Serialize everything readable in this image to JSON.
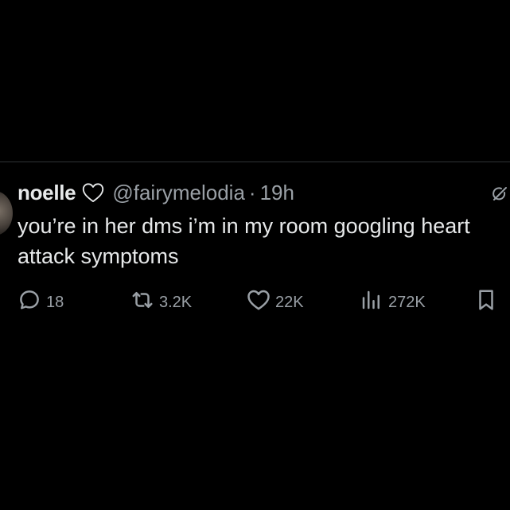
{
  "tweet": {
    "display_name": "noelle",
    "name_icon": "heart-outline-icon",
    "handle": "@fairymelodia",
    "separator": "·",
    "time": "19h",
    "text": "you’re in her dms i’m in my room googling heart attack symptoms"
  },
  "actions": {
    "reply": {
      "icon": "reply-icon",
      "count": "18"
    },
    "retweet": {
      "icon": "retweet-icon",
      "count": "3.2K"
    },
    "like": {
      "icon": "heart-icon",
      "count": "22K"
    },
    "views": {
      "icon": "views-icon",
      "count": "272K"
    },
    "bookmark": {
      "icon": "bookmark-icon"
    }
  },
  "colors": {
    "background": "#000000",
    "text_primary": "#e7e9ea",
    "text_secondary": "#9aa0a6",
    "divider": "#2f3336"
  }
}
